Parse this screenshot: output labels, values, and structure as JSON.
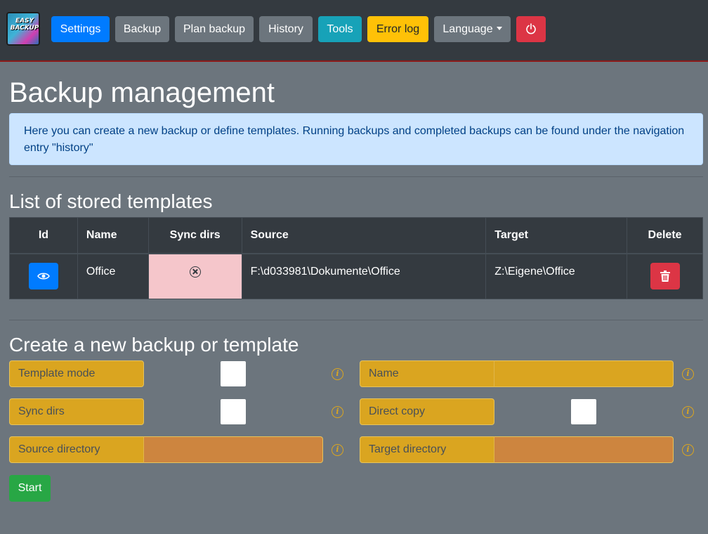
{
  "app": {
    "logo_text": "EASY BACKUP"
  },
  "nav": {
    "settings": "Settings",
    "backup": "Backup",
    "plan_backup": "Plan backup",
    "history": "History",
    "tools": "Tools",
    "error_log": "Error log",
    "language": "Language"
  },
  "page": {
    "title": "Backup management",
    "info": "Here you can create a new backup or define templates. Running backups and completed backups can be found under the navigation entry \"history\""
  },
  "templates": {
    "title": "List of stored templates",
    "columns": [
      "Id",
      "Name",
      "Sync dirs",
      "Source",
      "Target",
      "Delete"
    ],
    "rows": [
      {
        "name": "Office",
        "sync_dirs": false,
        "source": "F:\\d033981\\Dokumente\\Office",
        "target": "Z:\\Eigene\\Office"
      }
    ]
  },
  "form": {
    "title": "Create a new backup or template",
    "template_mode_label": "Template mode",
    "sync_dirs_label": "Sync dirs",
    "source_directory_label": "Source directory",
    "name_label": "Name",
    "direct_copy_label": "Direct copy",
    "target_directory_label": "Target directory",
    "name_value": "",
    "source_directory_value": "",
    "target_directory_value": "",
    "template_mode_checked": false,
    "sync_dirs_checked": false,
    "direct_copy_checked": false,
    "start_label": "Start"
  },
  "colors": {
    "navbar": "#343a40",
    "background": "#6c757d",
    "primary": "#007bff",
    "info": "#17a2b8",
    "warning": "#ffc107",
    "danger": "#dc3545",
    "success": "#28a745",
    "field_gold": "#daa520",
    "field_orange": "#cd853f",
    "sync_false": "#f5c6cb"
  },
  "icons": {
    "view": "eye-icon",
    "delete": "trash-icon",
    "power": "power-icon",
    "info": "info-icon",
    "sync_false": "circle-x-icon"
  }
}
